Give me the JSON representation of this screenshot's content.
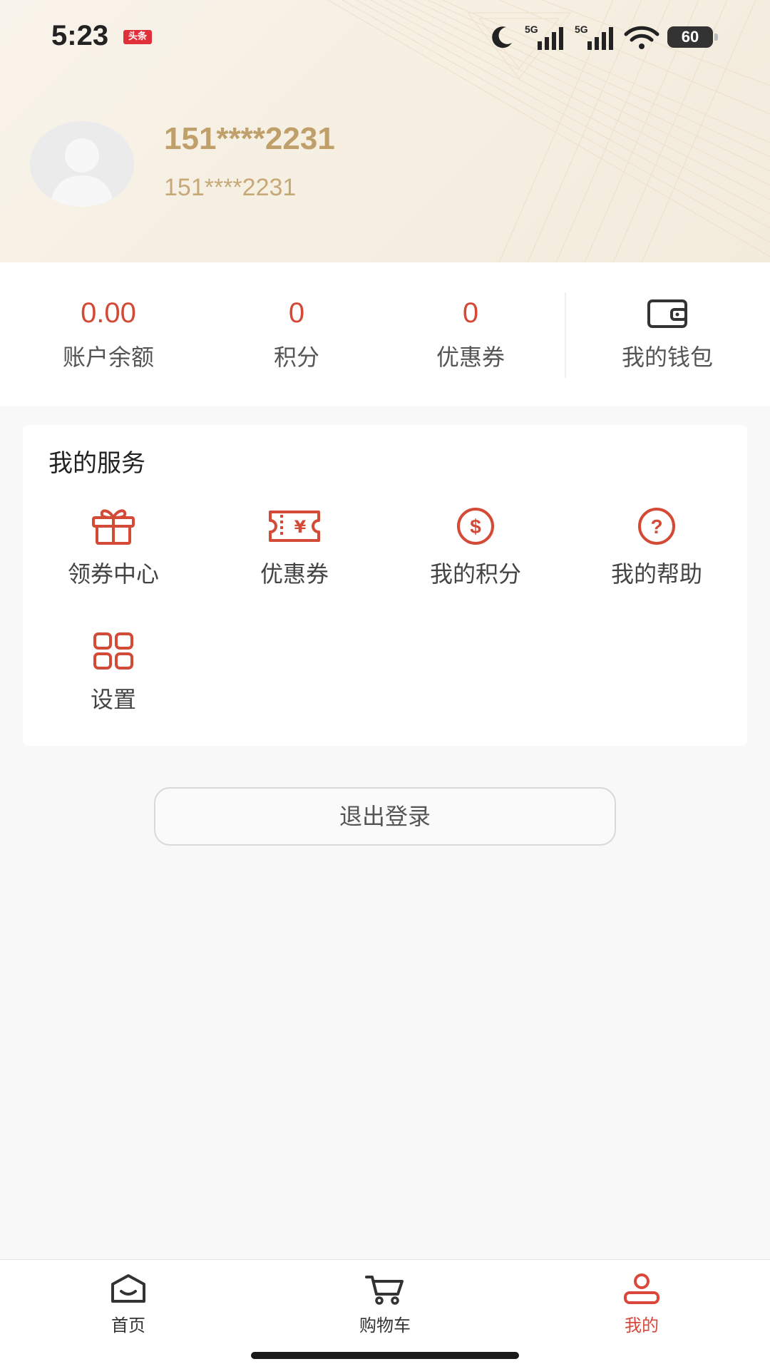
{
  "status_bar": {
    "time": "5:23",
    "badge": "头条",
    "battery": "60",
    "network_1": "5G",
    "network_2": "5G"
  },
  "profile": {
    "name": "151****2231",
    "phone": "151****2231"
  },
  "stats": [
    {
      "value": "0.00",
      "label": "账户余额"
    },
    {
      "value": "0",
      "label": "积分"
    },
    {
      "value": "0",
      "label": "优惠券"
    }
  ],
  "wallet": {
    "label": "我的钱包",
    "icon": "wallet-icon"
  },
  "services": {
    "title": "我的服务",
    "items": [
      {
        "label": "领券中心",
        "icon": "gift-icon"
      },
      {
        "label": "优惠券",
        "icon": "coupon-icon"
      },
      {
        "label": "我的积分",
        "icon": "dollar-coin-icon"
      },
      {
        "label": "我的帮助",
        "icon": "question-icon"
      },
      {
        "label": "设置",
        "icon": "grid-icon"
      }
    ]
  },
  "logout_label": "退出登录",
  "tabbar": {
    "items": [
      {
        "label": "首页",
        "icon": "home-icon",
        "active": false
      },
      {
        "label": "购物车",
        "icon": "cart-icon",
        "active": false
      },
      {
        "label": "我的",
        "icon": "user-icon",
        "active": true
      }
    ]
  },
  "colors": {
    "accent": "#d34a37",
    "gold": "#c0a06a",
    "header_bg": "#f6efe2"
  }
}
